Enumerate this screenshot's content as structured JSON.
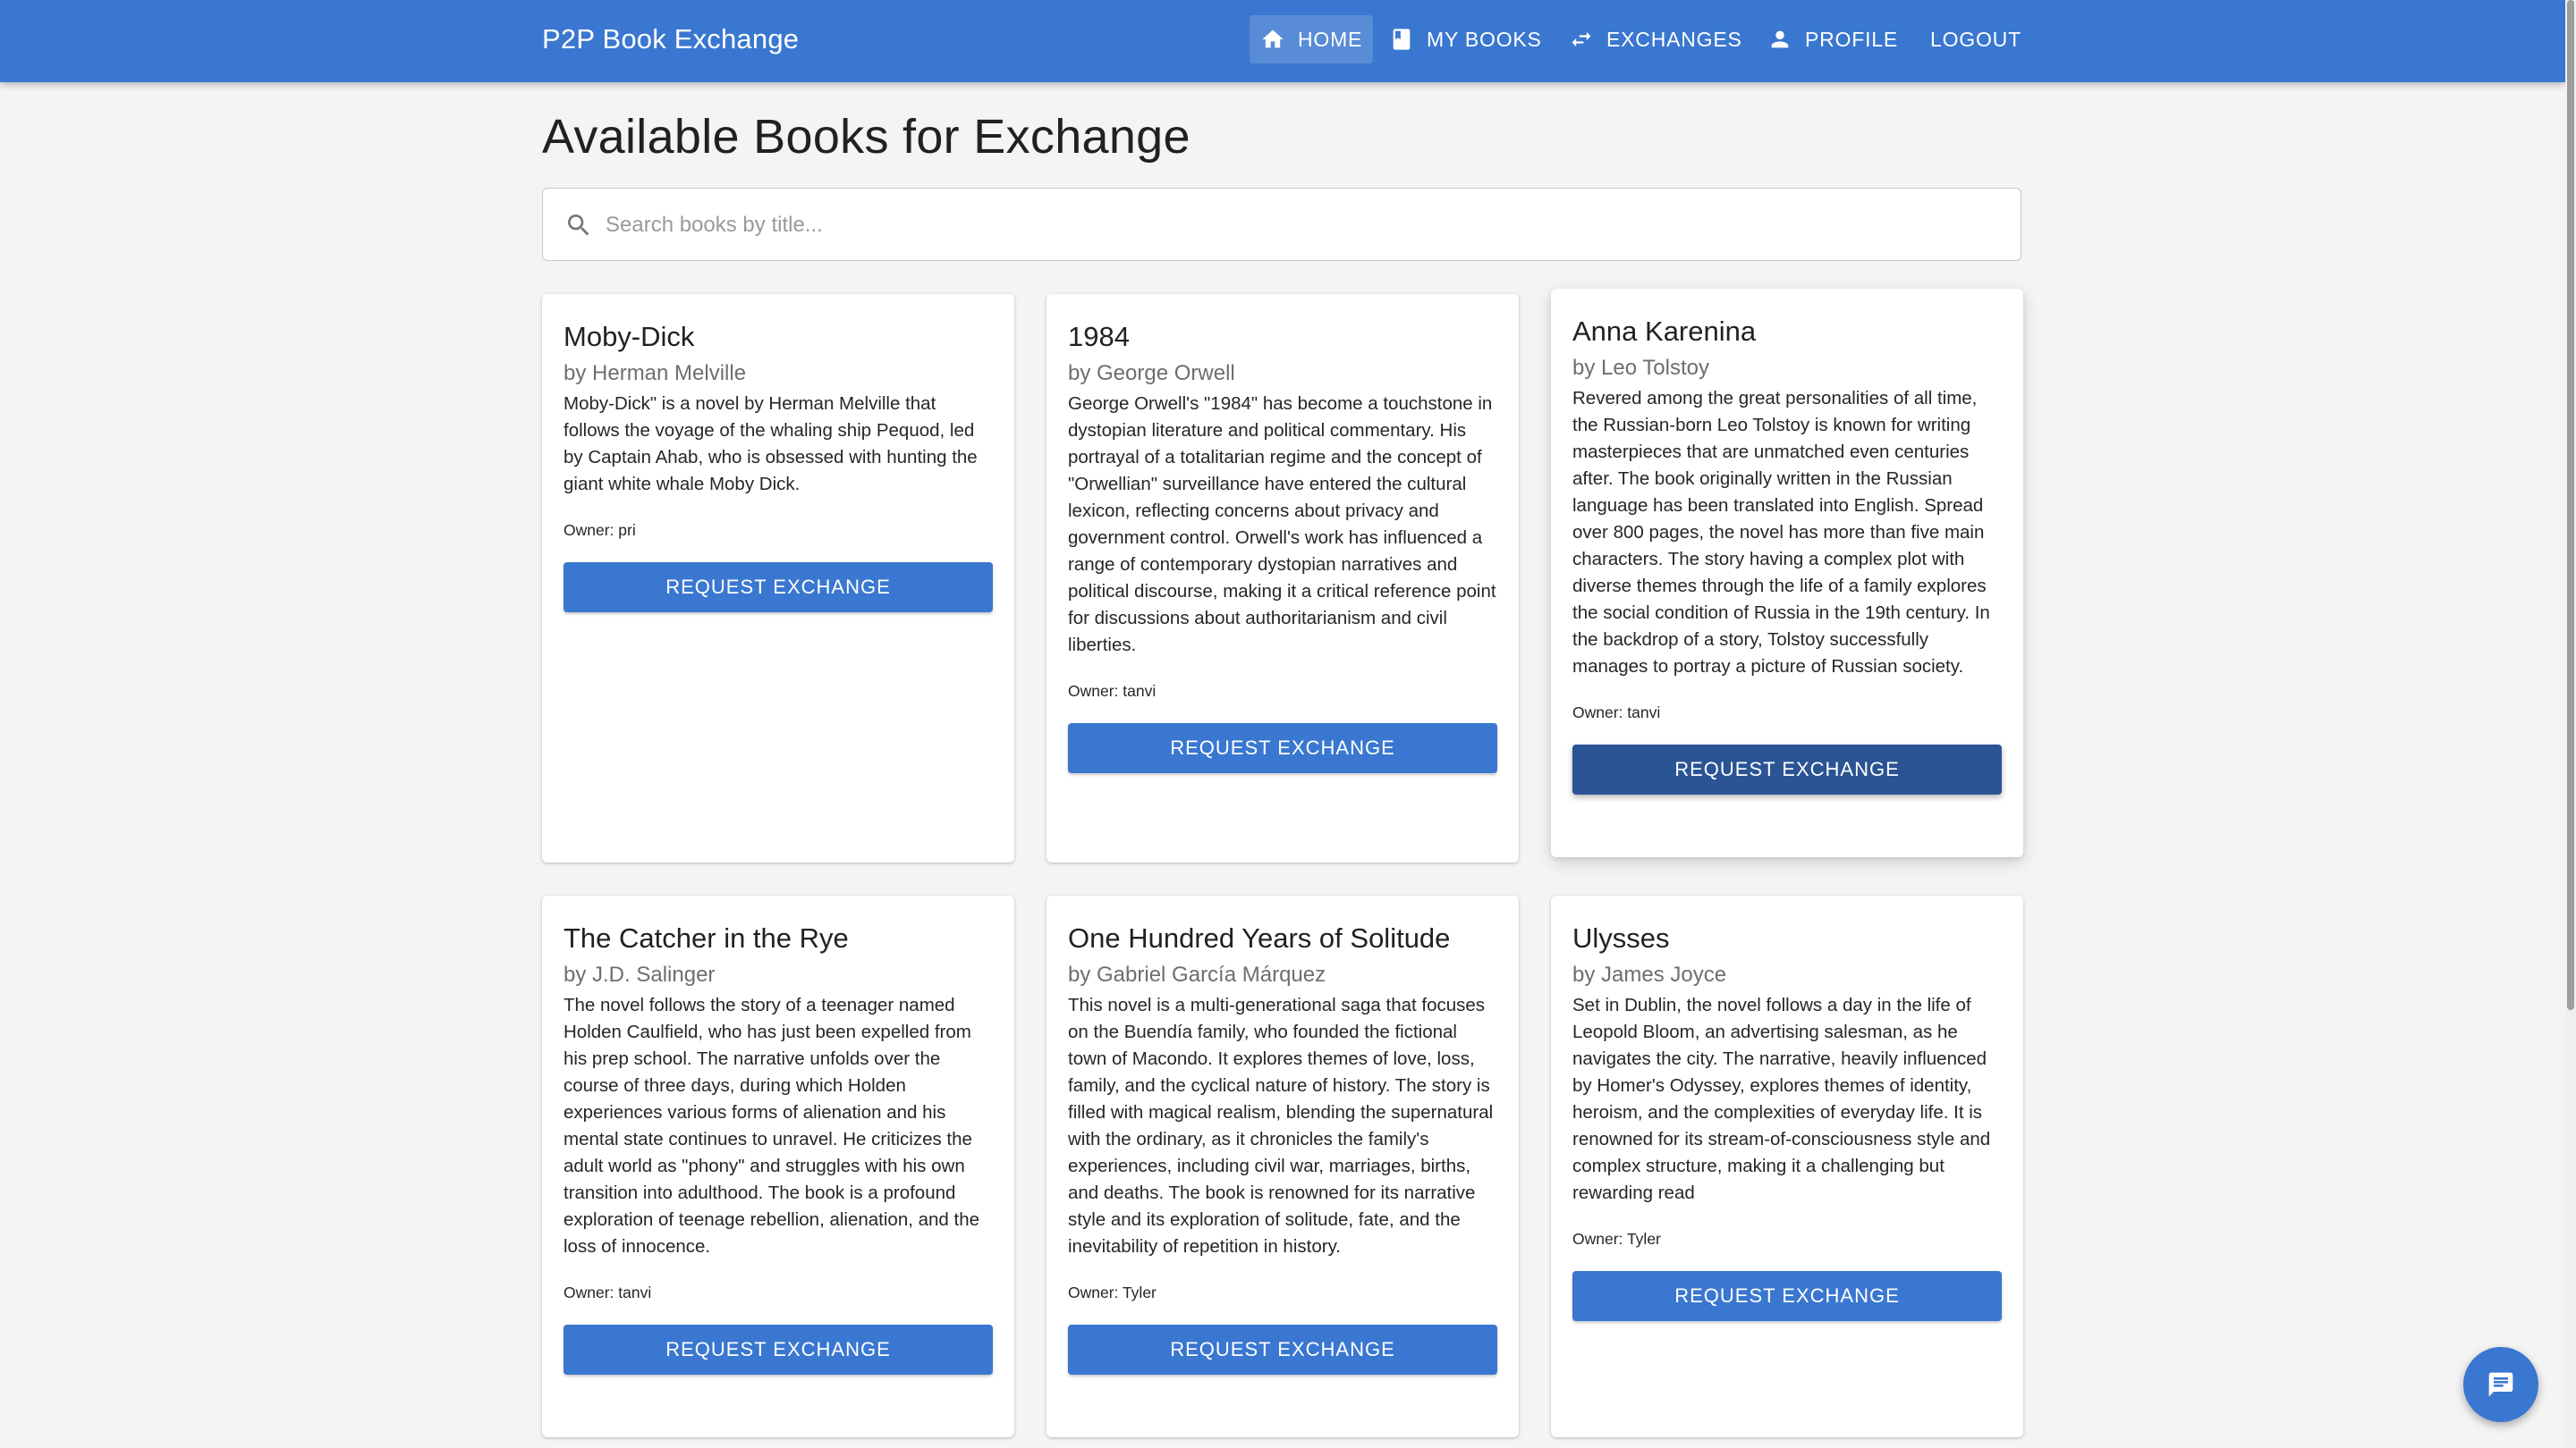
{
  "app": {
    "brand": "P2P Book Exchange"
  },
  "nav": [
    {
      "label": "HOME",
      "icon": "home-icon"
    },
    {
      "label": "MY BOOKS",
      "icon": "book-icon"
    },
    {
      "label": "EXCHANGES",
      "icon": "swap-icon"
    },
    {
      "label": "PROFILE",
      "icon": "person-icon"
    },
    {
      "label": "LOGOUT"
    }
  ],
  "page": {
    "title": "Available Books for Exchange"
  },
  "search": {
    "placeholder": "Search books by title...",
    "value": ""
  },
  "books": [
    {
      "title": "Moby-Dick",
      "author": "by Herman Melville",
      "description": "Moby-Dick\" is a novel by Herman Melville that follows the voyage of the whaling ship Pequod, led by Captain Ahab, who is obsessed with hunting the giant white whale Moby Dick.",
      "owner": "Owner: pri",
      "button": "REQUEST EXCHANGE"
    },
    {
      "title": "1984",
      "author": "by George Orwell",
      "description": "George Orwell's \"1984\" has become a touchstone in dystopian literature and political commentary. His portrayal of a totalitarian regime and the concept of \"Orwellian\" surveillance have entered the cultural lexicon, reflecting concerns about privacy and government control. Orwell's work has influenced a range of contemporary dystopian narratives and political discourse, making it a critical reference point for discussions about authoritarianism and civil liberties.",
      "owner": "Owner: tanvi",
      "button": "REQUEST EXCHANGE"
    },
    {
      "title": "Anna Karenina",
      "author": "by Leo Tolstoy",
      "description": "Revered among the great personalities of all time, the Russian-born Leo Tolstoy is known for writing masterpieces that are unmatched even centuries after. The book originally written in the Russian language has been translated into English. Spread over 800 pages, the novel has more than five main characters. The story having a complex plot with diverse themes through the life of a family explores the social condition of Russia in the 19th century. In the backdrop of a story, Tolstoy successfully manages to portray a picture of Russian society.",
      "owner": "Owner: tanvi",
      "button": "REQUEST EXCHANGE"
    },
    {
      "title": "The Catcher in the Rye",
      "author": "by J.D. Salinger",
      "description": "The novel follows the story of a teenager named Holden Caulfield, who has just been expelled from his prep school. The narrative unfolds over the course of three days, during which Holden experiences various forms of alienation and his mental state continues to unravel. He criticizes the adult world as \"phony\" and struggles with his own transition into adulthood. The book is a profound exploration of teenage rebellion, alienation, and the loss of innocence.",
      "owner": "Owner: tanvi",
      "button": "REQUEST EXCHANGE"
    },
    {
      "title": "One Hundred Years of Solitude",
      "author": "by Gabriel García Márquez",
      "description": "This novel is a multi-generational saga that focuses on the Buendía family, who founded the fictional town of Macondo. It explores themes of love, loss, family, and the cyclical nature of history. The story is filled with magical realism, blending the supernatural with the ordinary, as it chronicles the family's experiences, including civil war, marriages, births, and deaths. The book is renowned for its narrative style and its exploration of solitude, fate, and the inevitability of repetition in history.",
      "owner": "Owner: Tyler",
      "button": "REQUEST EXCHANGE"
    },
    {
      "title": "Ulysses",
      "author": "by James Joyce",
      "description": "Set in Dublin, the novel follows a day in the life of Leopold Bloom, an advertising salesman, as he navigates the city. The narrative, heavily influenced by Homer's Odyssey, explores themes of identity, heroism, and the complexities of everyday life. It is renowned for its stream-of-consciousness style and complex structure, making it a challenging but rewarding read",
      "owner": "Owner: Tyler",
      "button": "REQUEST EXCHANGE"
    }
  ],
  "fab": {
    "icon": "chat-icon"
  },
  "colors": {
    "primary": "#3a77d0",
    "primary_dark": "#2a5494",
    "background": "#f4f4f4"
  }
}
